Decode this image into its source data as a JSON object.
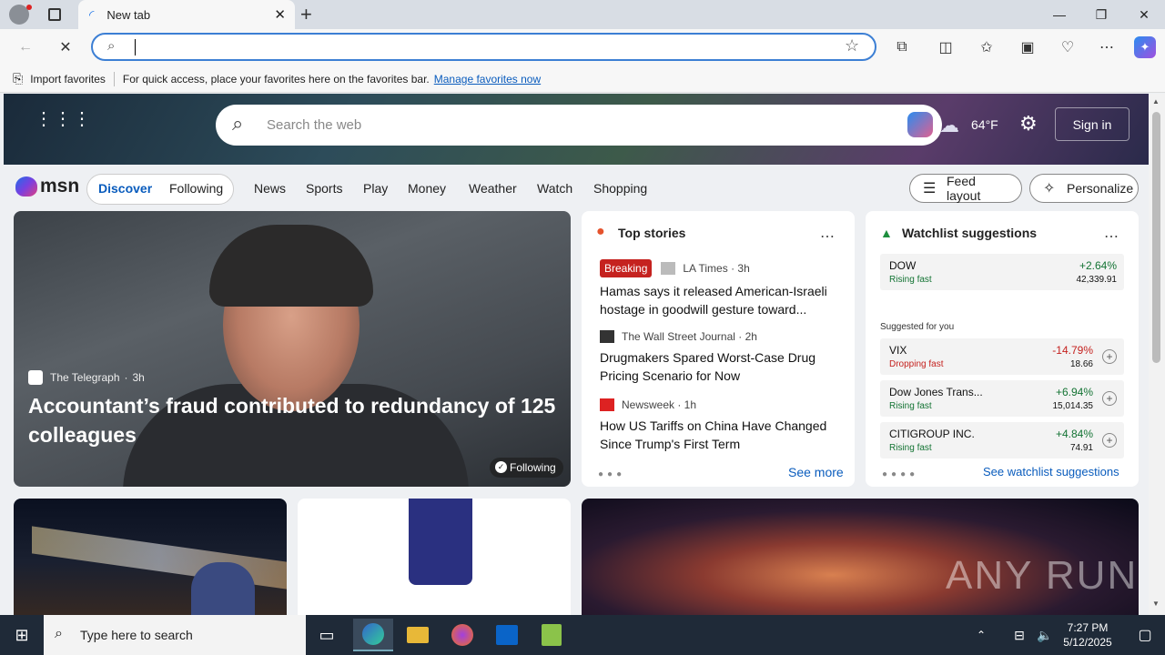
{
  "browser": {
    "tab_title": "New tab",
    "address_value": "",
    "favorites_import": "Import favorites",
    "favorites_hint": "For quick access, place your favorites here on the favorites bar.",
    "favorites_link": "Manage favorites now"
  },
  "msn": {
    "search_placeholder": "Search the web",
    "temperature": "64°F",
    "signin": "Sign in",
    "logo": "msn",
    "tabs": [
      "Discover",
      "Following"
    ],
    "nav": [
      "News",
      "Sports",
      "Play",
      "Money",
      "Weather",
      "Watch",
      "Shopping"
    ],
    "feed_layout": "Feed layout",
    "personalize": "Personalize"
  },
  "lead": {
    "source": "The Telegraph",
    "age": "3h",
    "headline": "Accountant’s fraud contributed to redundancy of 125 colleagues",
    "following": "Following"
  },
  "top_stories": {
    "title": "Top stories",
    "items": [
      {
        "badge": "Breaking",
        "source": "LA Times · 3h",
        "headline": "Hamas says it released American-Israeli hostage in goodwill gesture toward..."
      },
      {
        "source": "The Wall Street Journal · 2h",
        "headline": "Drugmakers Spared Worst-Case Drug Pricing Scenario for Now"
      },
      {
        "source": "Newsweek · 1h",
        "headline": "How US Tariffs on China Have Changed Since Trump's First Term"
      }
    ],
    "see_more": "See more"
  },
  "watchlist": {
    "title": "Watchlist suggestions",
    "suggested_label": "Suggested for you",
    "stocks": [
      {
        "name": "DOW",
        "status": "Rising fast",
        "change": "+2.64%",
        "price": "42,339.91"
      },
      {
        "name": "VIX",
        "status": "Dropping fast",
        "change": "-14.79%",
        "price": "18.66"
      },
      {
        "name": "Dow Jones Trans...",
        "status": "Rising fast",
        "change": "+6.94%",
        "price": "15,014.35"
      },
      {
        "name": "CITIGROUP INC.",
        "status": "Rising fast",
        "change": "+4.84%",
        "price": "74.91"
      }
    ],
    "see_link": "See watchlist suggestions"
  },
  "taskbar": {
    "search_placeholder": "Type here to search",
    "time": "7:27 PM",
    "date": "5/12/2025"
  },
  "watermark": "ANY RUN"
}
